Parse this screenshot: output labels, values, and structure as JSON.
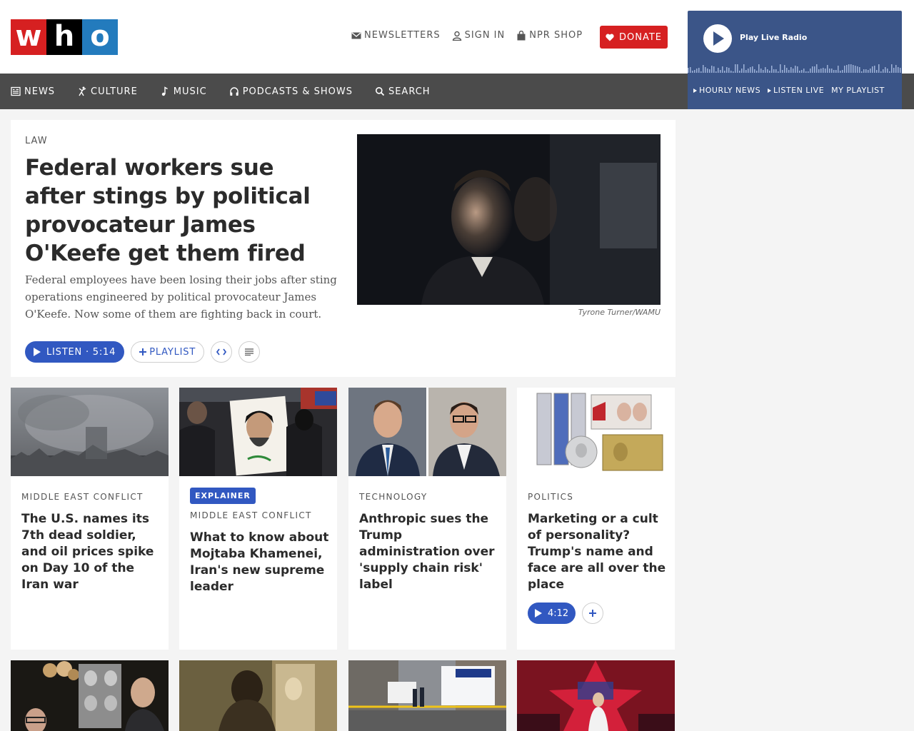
{
  "brand": {
    "logo_letters": [
      "w",
      "h",
      "o"
    ],
    "logo_colors": [
      "#d62021",
      "#000000",
      "#237bbd"
    ]
  },
  "utility": {
    "newsletters": "NEWSLETTERS",
    "sign_in": "SIGN IN",
    "shop": "NPR SHOP",
    "donate": "DONATE"
  },
  "nav": {
    "news": "NEWS",
    "culture": "CULTURE",
    "music": "MUSIC",
    "podcasts": "PODCASTS & SHOWS",
    "search": "SEARCH"
  },
  "player": {
    "title": "Play Live Radio",
    "hourly": "HOURLY NEWS",
    "listen_live": "LISTEN LIVE",
    "playlist": "MY PLAYLIST"
  },
  "hero": {
    "slug": "LAW",
    "title": "Federal workers sue after stings by political provocateur James O'Keefe get them fired",
    "teaser": "Federal employees have been losing their jobs after sting operations engineered by political provocateur James O'Keefe. Now some of them are fighting back in court.",
    "credit": "Tyrone Turner/WAMU",
    "listen": "LISTEN · 5:14",
    "playlist": "PLAYLIST"
  },
  "cards": [
    {
      "slug": "MIDDLE EAST CONFLICT",
      "title": "The U.S. names its 7th dead soldier, and oil prices spike on Day 10 of the Iran war"
    },
    {
      "badge": "EXPLAINER",
      "slug": "MIDDLE EAST CONFLICT",
      "title": "What to know about Mojtaba Khamenei, Iran's new supreme leader"
    },
    {
      "slug": "TECHNOLOGY",
      "title": "Anthropic sues the Trump administration over 'supply chain risk' label"
    },
    {
      "slug": "POLITICS",
      "title": "Marketing or a cult of personality? Trump's name and face are all over the place",
      "duration": "4:12"
    }
  ],
  "colors": {
    "accent": "#3158c1",
    "nav_bg": "#4b4b4b",
    "player_bg": "#3b5588",
    "donate": "#d62021"
  }
}
